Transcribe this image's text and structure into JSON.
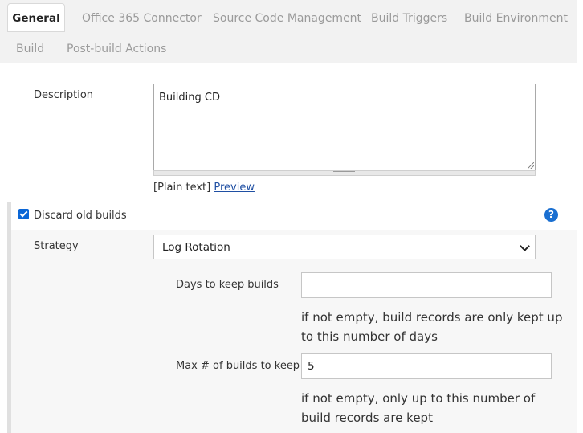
{
  "tabs": [
    {
      "label": "General",
      "active": true
    },
    {
      "label": "Office 365 Connector"
    },
    {
      "label": "Source Code Management"
    },
    {
      "label": "Build Triggers"
    },
    {
      "label": "Build Environment"
    },
    {
      "label": "Build"
    },
    {
      "label": "Post-build Actions"
    }
  ],
  "description": {
    "label": "Description",
    "value": "Building CD",
    "format_prefix": "[Plain text]",
    "preview_link": "Preview"
  },
  "discard": {
    "label": "Discard old builds",
    "checked": true,
    "help_icon": "question-circle-icon",
    "help_glyph": "?",
    "strategy_label": "Strategy",
    "strategy_value": "Log Rotation",
    "days_label": "Days to keep builds",
    "days_value": "",
    "days_hint": "if not empty, build records are only kept up to this number of days",
    "max_label": "Max # of builds to keep",
    "max_value": "5",
    "max_hint": "if not empty, only up to this number of build records are kept"
  },
  "colors": {
    "accent": "#0a66d6",
    "link": "#1f4fa3",
    "help": "#1a6fd1"
  }
}
